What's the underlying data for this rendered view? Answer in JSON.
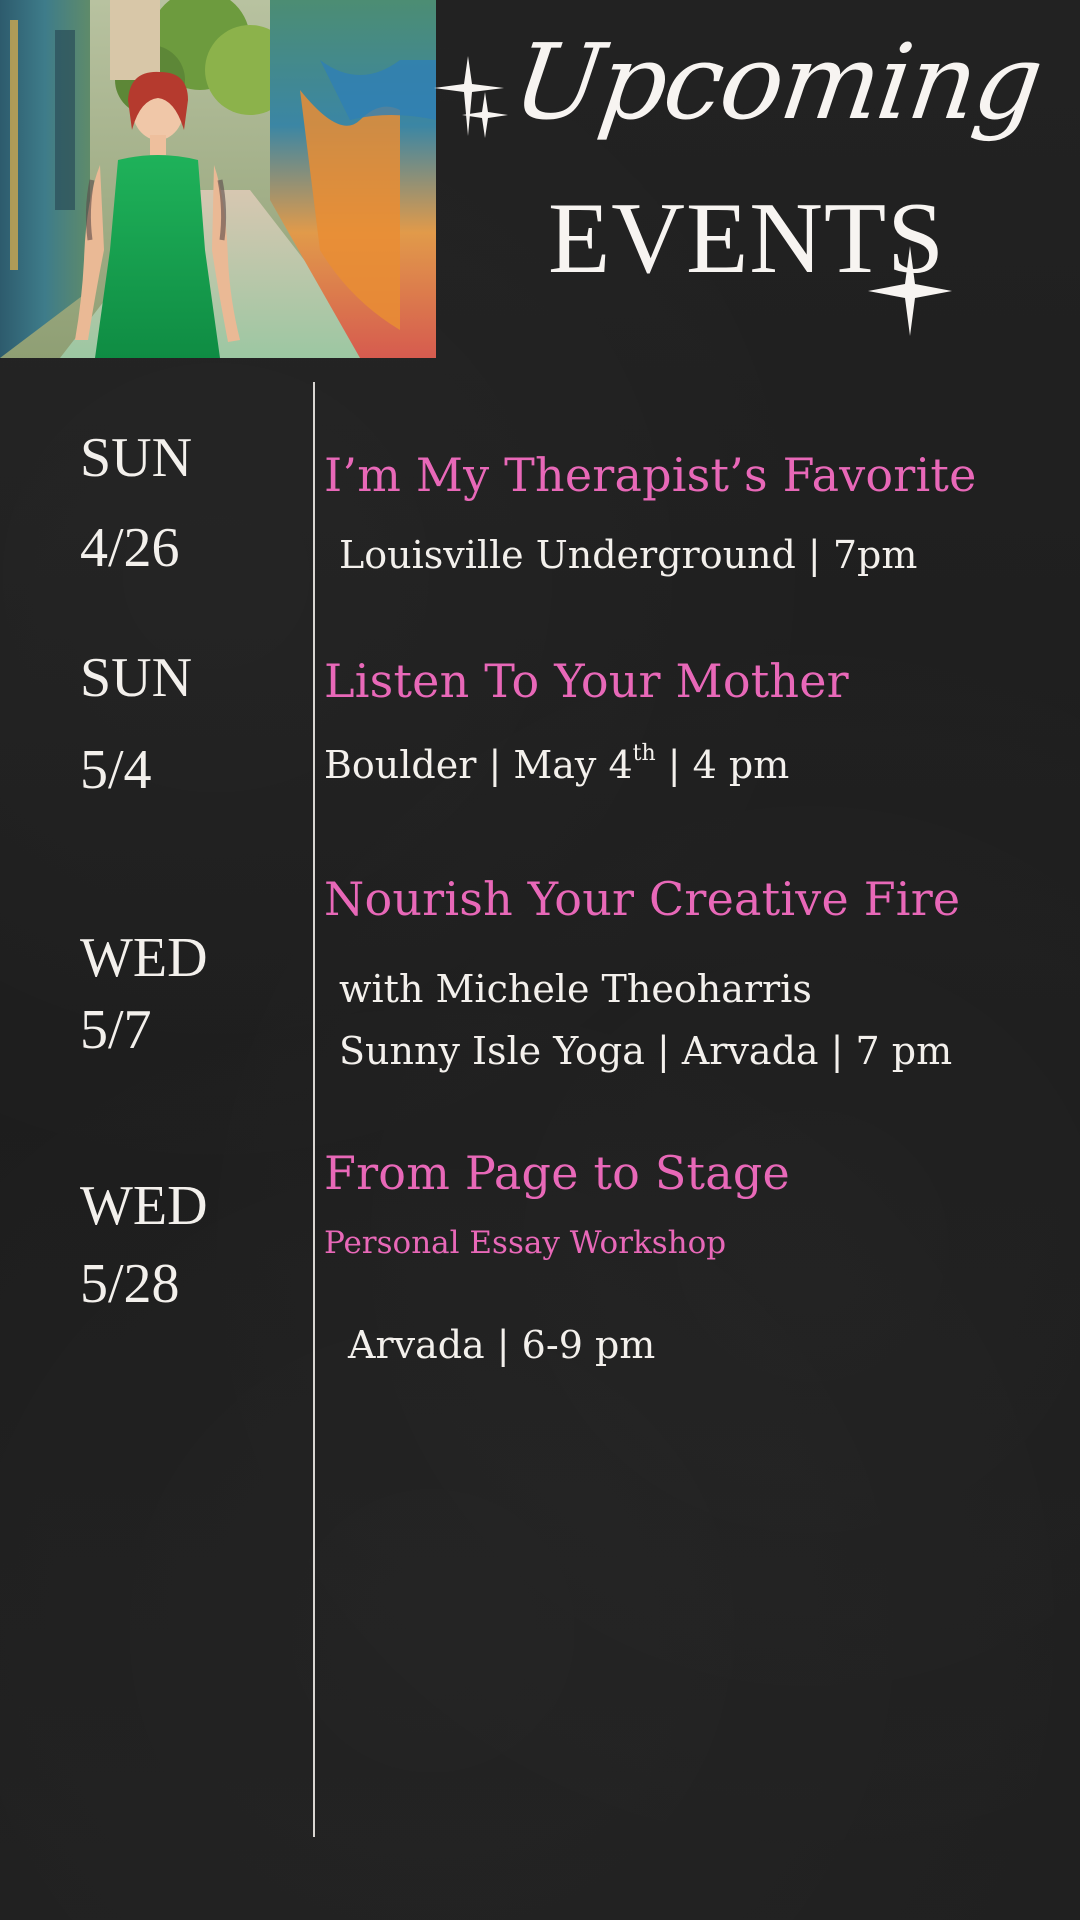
{
  "header": {
    "script_title": "Upcoming",
    "main_title": "EVENTS"
  },
  "events": [
    {
      "day": "SUN",
      "date": "4/26",
      "title": "I’m My Therapist’s Favorite",
      "details": [
        "Louisville Underground | 7pm"
      ]
    },
    {
      "day": "SUN",
      "date": "5/4",
      "title": "Listen To Your Mother",
      "details": [
        "Boulder | May 4"
      ],
      "detail_sup": "th",
      "detail_suffix": " | 4 pm"
    },
    {
      "day": "WED",
      "date": "5/7",
      "title": "Nourish Your Creative Fire",
      "details": [
        "with Michele Theoharris",
        "Sunny Isle Yoga | Arvada | 7 pm"
      ]
    },
    {
      "day": "WED",
      "date": "5/28",
      "title": "From Page to Stage",
      "subtitle": "Personal Essay Workshop",
      "details": [
        "Arvada | 6-9 pm"
      ]
    }
  ],
  "colors": {
    "background": "#1f1f1f",
    "text": "#f3f0ec",
    "accent": "#e868b8",
    "divider": "#d9d6d2"
  },
  "icons": [
    "sparkle-icon"
  ]
}
